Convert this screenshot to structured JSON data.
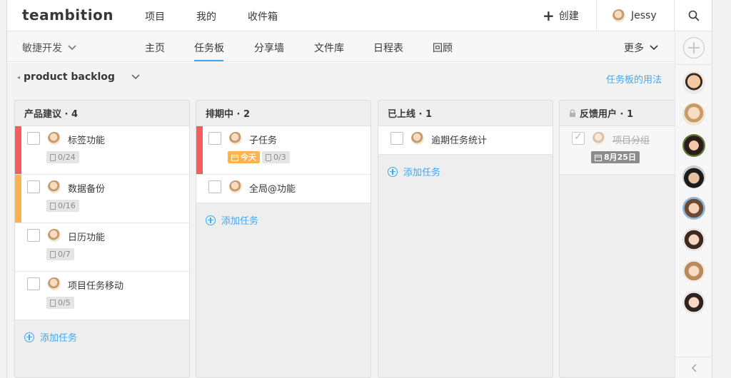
{
  "app": {
    "logo": "teambition"
  },
  "topnav": [
    {
      "label": "项目"
    },
    {
      "label": "我的"
    },
    {
      "label": "收件箱"
    }
  ],
  "create_label": "创建",
  "user": {
    "name": "Jessy"
  },
  "project": {
    "name": "敏捷开发"
  },
  "tabs": [
    {
      "label": "主页"
    },
    {
      "label": "任务板"
    },
    {
      "label": "分享墙"
    },
    {
      "label": "文件库"
    },
    {
      "label": "日程表"
    },
    {
      "label": "回顾"
    }
  ],
  "active_tab": "任务板",
  "more_label": "更多",
  "stage": {
    "name": "product backlog",
    "help_link": "任务板的用法"
  },
  "add_task_label": "添加任务",
  "columns": [
    {
      "title": "产品建议 · 4",
      "cards": [
        {
          "title": "标签功能",
          "subtasks": "0/24",
          "priority_color": "#f55c5c"
        },
        {
          "title": "数据备份",
          "subtasks": "0/16",
          "priority_color": "#ffb24d"
        },
        {
          "title": "日历功能",
          "subtasks": "0/7"
        },
        {
          "title": "项目任务移动",
          "subtasks": "0/5"
        }
      ]
    },
    {
      "title": "排期中 · 2",
      "cards": [
        {
          "title": "子任务",
          "due": "今天",
          "subtasks": "0/3",
          "priority_color": "#f55c5c"
        },
        {
          "title": "全局@功能"
        }
      ]
    },
    {
      "title": "已上线 · 1",
      "cards": [
        {
          "title": "逾期任务统计"
        }
      ]
    },
    {
      "title": "反馈用户 · 1",
      "locked": true,
      "cards": [
        {
          "title": "项目分组",
          "done": true,
          "date": "8月25日"
        }
      ]
    }
  ],
  "colors": {
    "accent": "#3da8f5",
    "high_priority": "#f55c5c",
    "medium_priority": "#ffb24d"
  }
}
